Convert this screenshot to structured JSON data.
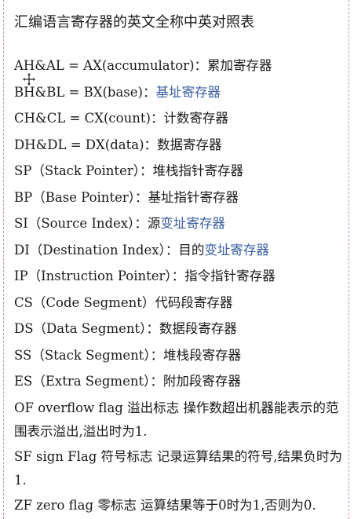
{
  "title": "汇编语言寄存器的英文全称中英对照表",
  "registers": [
    {
      "en": "AH&AL = AX(accumulator)：",
      "zh": "累加寄存器",
      "zh_link": ""
    },
    {
      "en": "BH&BL = BX(base)：",
      "zh": "",
      "zh_link": "基址寄存器"
    },
    {
      "en": "CH&CL = CX(count)：",
      "zh": "计数寄存器",
      "zh_link": ""
    },
    {
      "en": "DH&DL = DX(data)：",
      "zh": "数据寄存器",
      "zh_link": ""
    },
    {
      "en": "SP（Stack Pointer）：",
      "zh": "堆栈指针寄存器",
      "zh_link": ""
    },
    {
      "en": "BP（Base Pointer）：",
      "zh": "基址指针寄存器",
      "zh_link": ""
    },
    {
      "en": "SI（Source Index）：",
      "zh": "源",
      "zh_link": "变址寄存器"
    },
    {
      "en": "DI（Destination Index）：",
      "zh": "目的",
      "zh_link": "变址寄存器"
    },
    {
      "en": "IP（Instruction Pointer）：",
      "zh": "指令指针寄存器",
      "zh_link": ""
    },
    {
      "en": "CS（Code Segment）",
      "zh": "代码段寄存器",
      "zh_link": ""
    },
    {
      "en": "DS（Data Segment）：",
      "zh": "数据段寄存器",
      "zh_link": ""
    },
    {
      "en": "SS（Stack Segment）：",
      "zh": "堆栈段寄存器",
      "zh_link": ""
    },
    {
      "en": "ES（Extra Segment）：",
      "zh": "附加段寄存器",
      "zh_link": ""
    }
  ],
  "flags": [
    {
      "text": "OF overflow flag 溢出标志 操作数超出机器能表示的范围表示溢出,溢出时为1."
    },
    {
      "text": "SF sign Flag 符号标志 记录运算结果的符号,结果负时为1."
    },
    {
      "text": "ZF zero flag 零标志 运算结果等于0时为1,否则为0."
    }
  ],
  "cursor_icon": "move-cursor-icon"
}
